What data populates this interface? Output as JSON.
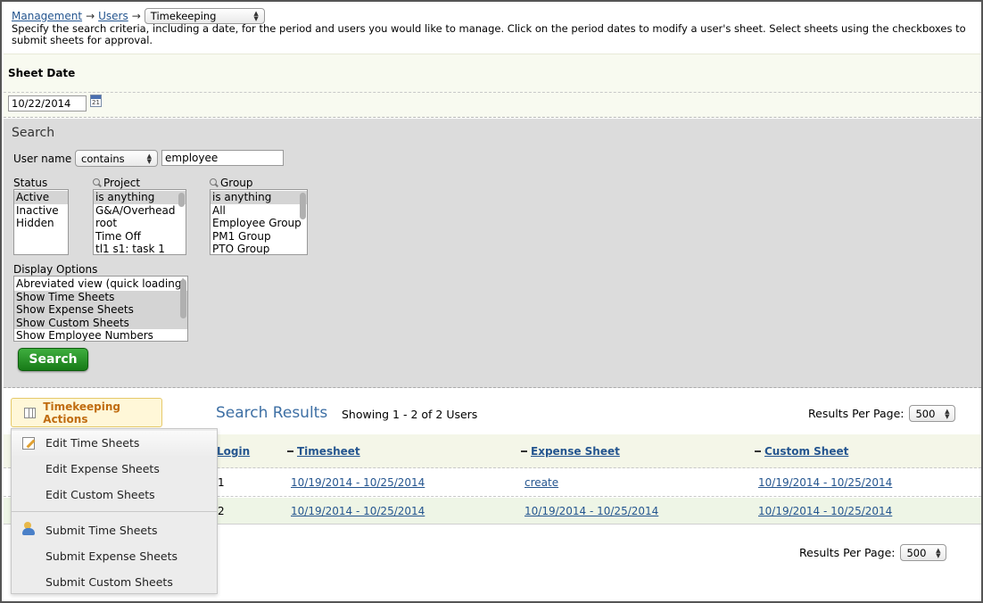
{
  "breadcrumb": {
    "management": "Management",
    "arrow1": "→",
    "users": "Users",
    "arrow2": "→",
    "section_select": "Timekeeping"
  },
  "description": "Specify the search criteria, including a date, for the period and users you would like to manage. Click on the period dates to modify a user's sheet. Select sheets using the checkboxes to submit sheets for approval.",
  "sheet_date": {
    "label": "Sheet Date",
    "value": "10/22/2014",
    "calendar_text": "21"
  },
  "search": {
    "title": "Search",
    "username_label": "User name",
    "username_operator": "contains",
    "username_value": "employee",
    "status_label": "Status",
    "status_options": [
      "Active",
      "Inactive",
      "Hidden"
    ],
    "project_label": "Project",
    "project_options": [
      "is anything",
      "G&A/Overhead",
      "root",
      "Time Off",
      "tl1 s1: task 1"
    ],
    "group_label": "Group",
    "group_options": [
      "is anything",
      "All",
      "Employee Group",
      "PM1 Group",
      "PTO Group"
    ],
    "display_label": "Display Options",
    "display_options": [
      "Abreviated view (quick loading)",
      "Show Time Sheets",
      "Show Expense Sheets",
      "Show Custom Sheets",
      "Show Employee Numbers"
    ],
    "search_button": "Search"
  },
  "results": {
    "actions_button": "Timekeeping Actions",
    "title": "Search Results",
    "showing": "Showing 1 - 2 of 2 Users",
    "rpp_label": "Results Per Page:",
    "rpp_value": "500",
    "columns": {
      "login": "Login",
      "timesheet": "Timesheet",
      "expense": "Expense Sheet",
      "custom": "Custom Sheet"
    },
    "rows": [
      {
        "login": "1",
        "timesheet": "10/19/2014 - 10/25/2014",
        "expense": "create",
        "custom": "10/19/2014 - 10/25/2014"
      },
      {
        "login": "2",
        "timesheet": "10/19/2014 - 10/25/2014",
        "expense": "10/19/2014 - 10/25/2014",
        "custom": "10/19/2014 - 10/25/2014"
      }
    ]
  },
  "menu": {
    "items": [
      "Edit Time Sheets",
      "Edit Expense Sheets",
      "Edit Custom Sheets",
      "Submit Time Sheets",
      "Submit Expense Sheets",
      "Submit Custom Sheets"
    ]
  }
}
